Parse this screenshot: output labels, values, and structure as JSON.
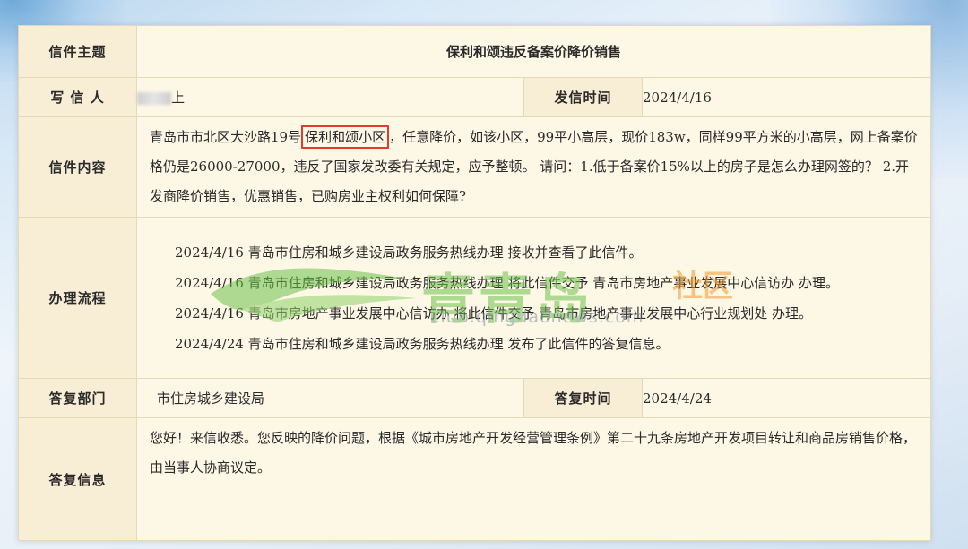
{
  "fields": {
    "subject_label": "信件主题",
    "subject": "保利和颂违反备案价降价销售",
    "writer_label": "写 信 人",
    "writer_suffix": "上",
    "send_time_label": "发信时间",
    "send_time": "2024/4/16",
    "content_label": "信件内容",
    "content_pre": "青岛市市北区大沙路19号",
    "content_highlight": "保利和颂小区",
    "content_post": "，任意降价，如该小区，99平小高层，现价183w，同样99平方米的小高层，网上备案价格仍是26000-27000，违反了国家发改委有关规定，应予整顿。 请问：1.低于备案价15%以上的房子是怎么办理网签的？ 2.开发商降价销售，优惠销售，已购房业主权利如何保障?",
    "flow_label": "办理流程",
    "flow": [
      "2024/4/16  青岛市住房和城乡建设局政务服务热线办理 接收并查看了此信件。",
      "2024/4/16  青岛市住房和城乡建设局政务服务热线办理 将此信件交予 青岛市房地产事业发展中心信访办 办理。",
      "2024/4/16  青岛市房地产事业发展中心信访办 将此信件交予 青岛市房地产事业发展中心行业规划处 办理。",
      "2024/4/24  青岛市住房和城乡建设局政务服务热线办理 发布了此信件的答复信息。"
    ],
    "reply_dept_label": "答复部门",
    "reply_dept": "市住房城乡建设局",
    "reply_time_label": "答复时间",
    "reply_time": "2024/4/24",
    "reply_info_label": "答复信息",
    "reply_info": "您好！来信收悉。您反映的降价问题，根据《城市房地产开发经营管理条例》第二十九条房地产开发项目转让和商品房销售价格，由当事人协商议定。"
  },
  "watermark": {
    "text": "青青岛",
    "sub": "社区",
    "url": "club.qingdaonews.com"
  },
  "colors": {
    "label_blue": "#2b5ea6",
    "highlight_red": "#e23b2e",
    "paper": "#fdf7e6"
  }
}
